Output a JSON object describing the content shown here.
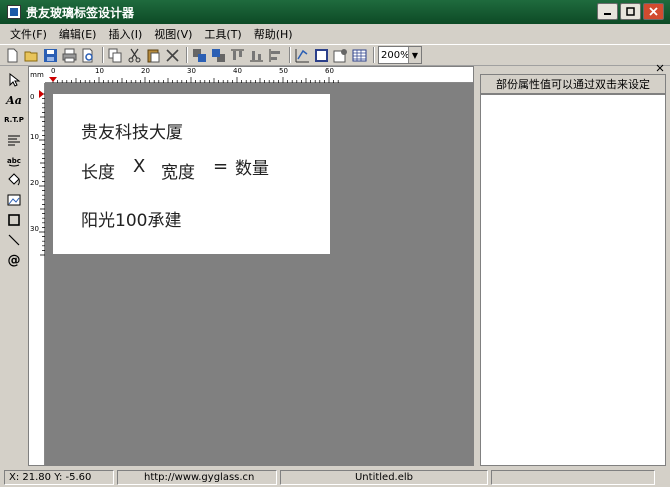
{
  "window": {
    "title": "贵友玻璃标签设计器"
  },
  "menu": [
    {
      "label": "文件(F)"
    },
    {
      "label": "编辑(E)"
    },
    {
      "label": "插入(I)"
    },
    {
      "label": "视图(V)"
    },
    {
      "label": "工具(T)"
    },
    {
      "label": "帮助(H)"
    }
  ],
  "toolbar": {
    "zoom_value": "200%"
  },
  "ruler": {
    "unit": "mm",
    "top_ticks": [
      "0",
      "10",
      "20",
      "30",
      "40",
      "50",
      "60"
    ],
    "left_ticks": [
      "0",
      "10",
      "20",
      "30"
    ]
  },
  "left_tools": {
    "text_tool_label": "Aa",
    "rtp_tool_label": "R.T.P",
    "at_tool_label": "@"
  },
  "label": {
    "line1": "贵友科技大厦",
    "line2_a": "长度",
    "line2_x": "X",
    "line2_b": "宽度",
    "line2_eq": "=",
    "line2_c": "数量",
    "line3": "阳光100承建"
  },
  "panel": {
    "note": "部份属性值可以通过双击来设定"
  },
  "status": {
    "coords": "X: 21.80  Y: -5.60",
    "url": "http://www.gyglass.cn",
    "file": "Untitled.elb"
  }
}
